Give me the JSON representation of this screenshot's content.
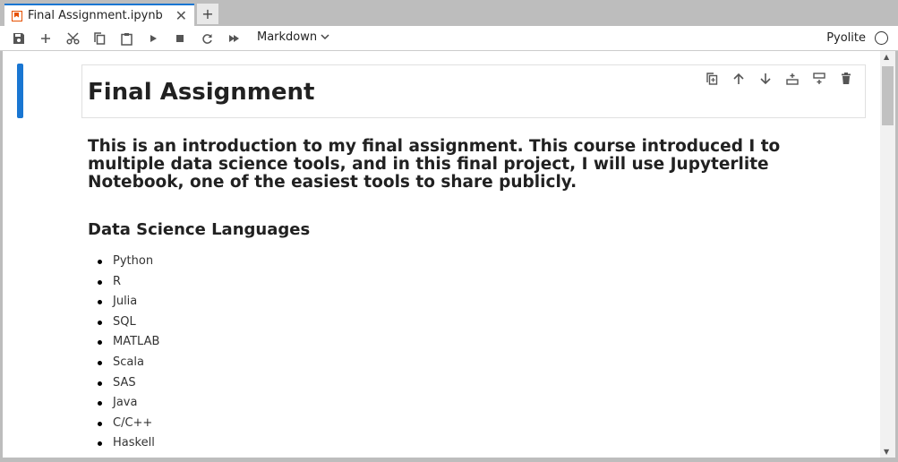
{
  "tab": {
    "title": "Final Assignment.ipynb",
    "close_glyph": "✕",
    "new_glyph": "+"
  },
  "toolbar": {
    "buttons": [
      "save-icon",
      "add-cell-icon",
      "cut-icon",
      "copy-icon",
      "paste-icon",
      "run-icon",
      "stop-icon",
      "restart-icon",
      "run-all-icon"
    ],
    "cell_type": "Markdown",
    "kernel_name": "Pyolite"
  },
  "cell_toolbar": [
    "duplicate-icon",
    "move-up-icon",
    "move-down-icon",
    "insert-above-icon",
    "insert-below-icon",
    "delete-icon"
  ],
  "notebook": {
    "heading": "Final Assignment",
    "intro": "This is an introduction to my final assignment. This course introduced I to multiple data science tools, and in this final project, I will use Jupyterlite Notebook, one of the easiest tools to share publicly.",
    "section_title": "Data Science Languages",
    "languages": [
      "Python",
      "R",
      "Julia",
      "SQL",
      "MATLAB",
      "Scala",
      "SAS",
      "Java",
      "C/C++",
      "Haskell"
    ]
  },
  "colors": {
    "accent": "#1976d2",
    "tab_icon": "#e65100"
  }
}
